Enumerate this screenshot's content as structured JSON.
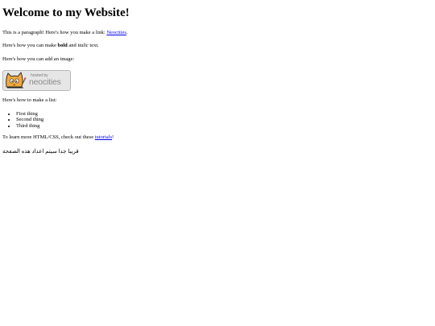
{
  "heading": "Welcome to my Website!",
  "para1": {
    "text": "This is a paragraph! Here's how you make a link: ",
    "link": "Neocities",
    "after": "."
  },
  "para2": {
    "before": "Here's how you can make ",
    "bold": "bold",
    "middle": " and ",
    "italic": "italic",
    "after": " text."
  },
  "para3": "Here's how you can add an image:",
  "badge": {
    "hosted": "hosted by",
    "brand": "neocities",
    "icon": "neocities-cat-icon"
  },
  "para4": "Here's how to make a list:",
  "list": [
    "First thing",
    "Second thing",
    "Third thing"
  ],
  "para5": {
    "before": "To learn more HTML/CSS, check out these ",
    "link": "tutorials",
    "after": "!"
  },
  "arabic": "قريبا جدا سيتم اعداد هذه الصفحة"
}
